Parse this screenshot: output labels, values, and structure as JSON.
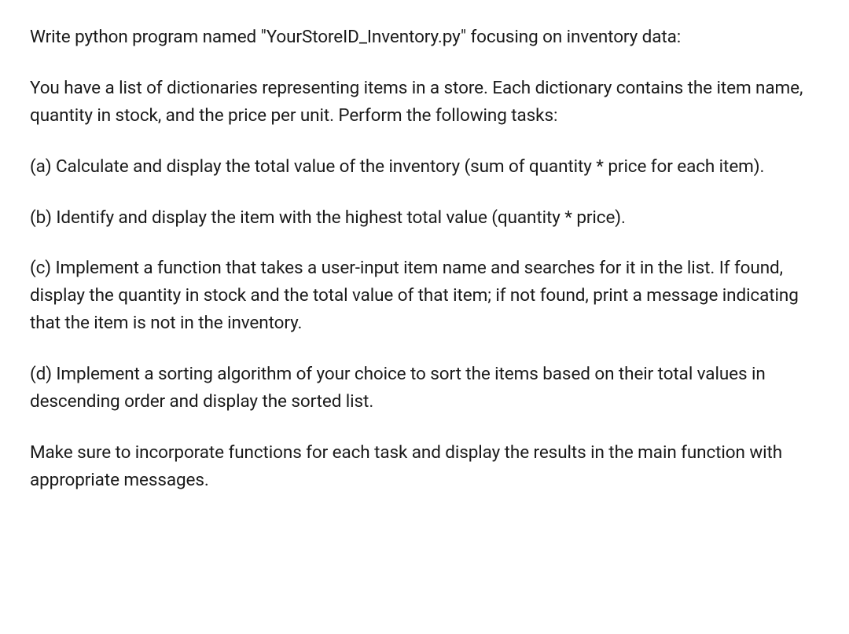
{
  "document": {
    "paragraphs": [
      "Write python program named \"YourStoreID_Inventory.py\" focusing on inventory data:",
      "You have a list of dictionaries representing items in a store. Each dictionary contains the item name, quantity in stock, and the price per unit. Perform the following tasks:",
      "(a) Calculate and display the total value of the inventory (sum of quantity * price for each item).",
      "(b) Identify and display the item with the highest total value (quantity * price).",
      "(c) Implement a function that takes a user-input item name and searches for it in the list. If found, display the quantity in stock and the total value of that item; if not found, print a message indicating that the item is not in the inventory.",
      "(d) Implement a sorting algorithm of your choice to sort the items based on their total values in descending order and display the sorted list.",
      "Make sure to incorporate functions for each task and display the results in the main function with appropriate messages."
    ]
  }
}
